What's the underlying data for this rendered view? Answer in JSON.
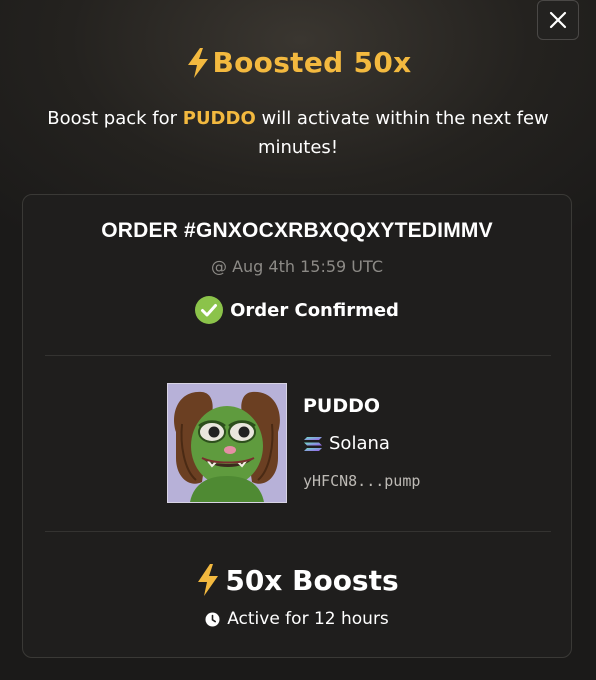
{
  "header": {
    "title": "Boosted 50x",
    "icon": "lightning-bolt-icon",
    "accent_color": "#f3b93f"
  },
  "message": {
    "prefix": "Boost pack for",
    "token": "PUDDO",
    "suffix": "will activate within the next few minutes!"
  },
  "order": {
    "id": "ORDER #GNXOCXRBXQQXYTEDIMMV",
    "time": "@ Aug 4th 15:59 UTC",
    "status": "Order Confirmed",
    "status_color": "#8bc34a"
  },
  "token": {
    "name": "PUDDO",
    "chain": "Solana",
    "address": "yHFCN8...pump",
    "image": "puddo-pepe-avatar"
  },
  "boost": {
    "label": "50x Boosts",
    "duration": "Active for 12 hours"
  },
  "close_icon": "close-icon"
}
